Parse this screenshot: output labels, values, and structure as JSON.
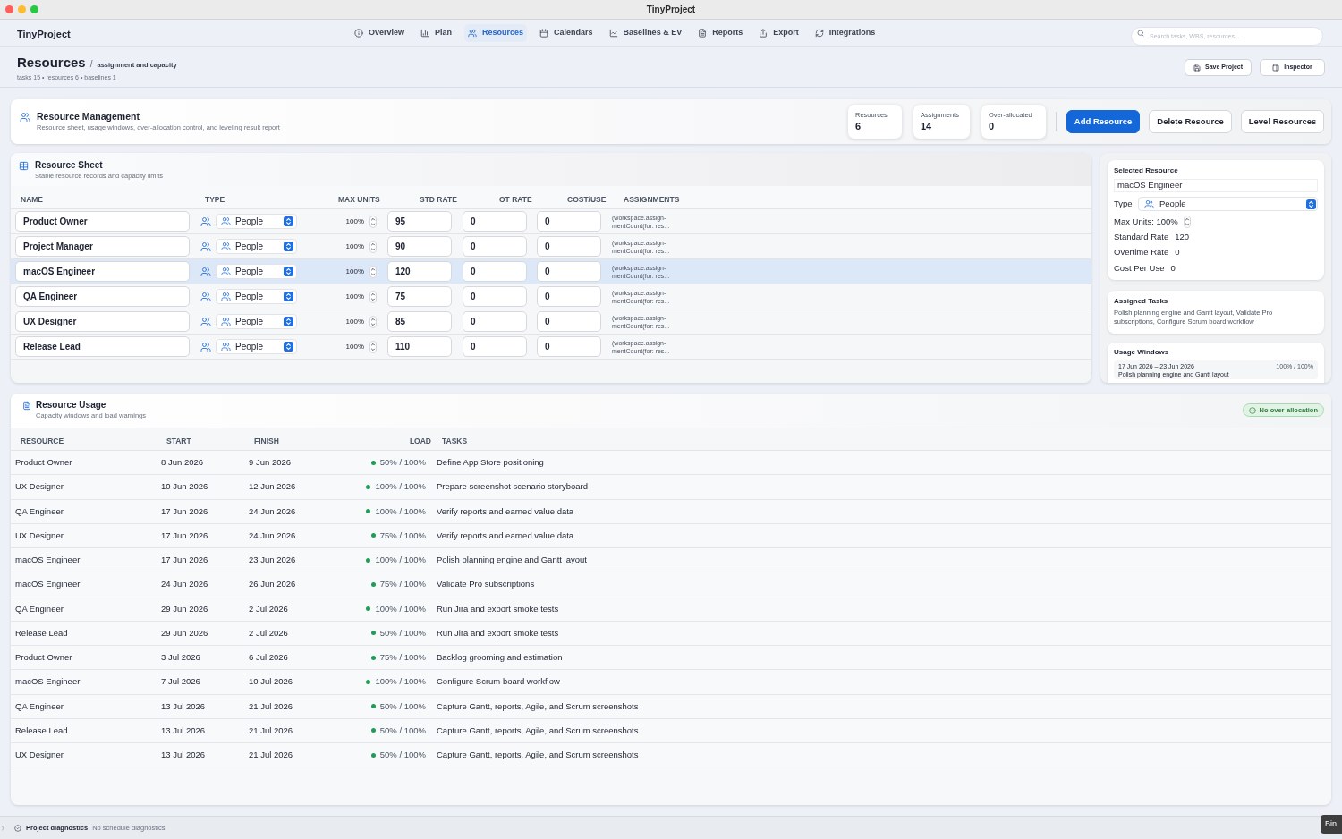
{
  "window": {
    "title": "TinyProject"
  },
  "toolbar": {
    "app_name": "TinyProject",
    "nav": [
      {
        "label": "Overview",
        "selected": false
      },
      {
        "label": "Plan",
        "selected": false
      },
      {
        "label": "Resources",
        "selected": true
      },
      {
        "label": "Calendars",
        "selected": false
      },
      {
        "label": "Baselines & EV",
        "selected": false
      },
      {
        "label": "Reports",
        "selected": false
      },
      {
        "label": "Export",
        "selected": false
      },
      {
        "label": "Integrations",
        "selected": false
      }
    ],
    "search": {
      "placeholder": "Search tasks, WBS, resources..."
    }
  },
  "page_header": {
    "title": "Resources",
    "separator": "/",
    "subtitle": "assignment and capacity",
    "meta": "tasks 15 • resources 6 • baselines 1",
    "actions": [
      "Save Project",
      "Inspector"
    ]
  },
  "resource_management": {
    "title": "Resource Management",
    "subtitle": "Resource sheet, usage windows, over-allocation control, and leveling result report",
    "stats": [
      {
        "label": "Resources",
        "value": "6"
      },
      {
        "label": "Assignments",
        "value": "14"
      },
      {
        "label": "Over-allocated",
        "value": "0"
      }
    ],
    "buttons": [
      {
        "label": "Add Resource",
        "kind": "primary"
      },
      {
        "label": "Delete Resource",
        "kind": "secondary"
      },
      {
        "label": "Level Resources",
        "kind": "secondary"
      }
    ]
  },
  "resource_sheet": {
    "title": "Resource Sheet",
    "subtitle": "Stable resource records and capacity limits",
    "columns": [
      "NAME",
      "TYPE",
      "MAX UNITS",
      "STD RATE",
      "OT RATE",
      "COST/USE",
      "ASSIGNMENTS"
    ],
    "rows": [
      {
        "name": "Product Owner",
        "type": "People",
        "max_units": "100%",
        "std_rate": "95",
        "ot_rate": "0",
        "cost_use": "0",
        "assignments": [
          "(workspace.assign-",
          "mentCount(for: res..."
        ],
        "selected": false
      },
      {
        "name": "Project Manager",
        "type": "People",
        "max_units": "100%",
        "std_rate": "90",
        "ot_rate": "0",
        "cost_use": "0",
        "assignments": [
          "(workspace.assign-",
          "mentCount(for: res..."
        ],
        "selected": false
      },
      {
        "name": "macOS Engineer",
        "type": "People",
        "max_units": "100%",
        "std_rate": "120",
        "ot_rate": "0",
        "cost_use": "0",
        "assignments": [
          "(workspace.assign-",
          "mentCount(for: res..."
        ],
        "selected": true
      },
      {
        "name": "QA Engineer",
        "type": "People",
        "max_units": "100%",
        "std_rate": "75",
        "ot_rate": "0",
        "cost_use": "0",
        "assignments": [
          "(workspace.assign-",
          "mentCount(for: res..."
        ],
        "selected": false
      },
      {
        "name": "UX Designer",
        "type": "People",
        "max_units": "100%",
        "std_rate": "85",
        "ot_rate": "0",
        "cost_use": "0",
        "assignments": [
          "(workspace.assign-",
          "mentCount(for: res..."
        ],
        "selected": false
      },
      {
        "name": "Release Lead",
        "type": "People",
        "max_units": "100%",
        "std_rate": "110",
        "ot_rate": "0",
        "cost_use": "0",
        "assignments": [
          "(workspace.assign-",
          "mentCount(for: res..."
        ],
        "selected": false
      }
    ]
  },
  "inspector": {
    "selected_resource": {
      "title": "Selected Resource",
      "name": "macOS Engineer",
      "type_label": "Type",
      "type": "People",
      "max_units": "Max Units: 100%",
      "fields": [
        {
          "label": "Standard Rate",
          "value": "120"
        },
        {
          "label": "Overtime Rate",
          "value": "0"
        },
        {
          "label": "Cost Per Use",
          "value": "0"
        }
      ]
    },
    "assigned_tasks": {
      "title": "Assigned Tasks",
      "text": "Polish planning engine and Gantt layout, Validate Pro subscriptions, Configure Scrum board workflow"
    },
    "usage_windows": {
      "title": "Usage Windows",
      "items": [
        {
          "range": "17 Jun 2026 – 23 Jun 2026",
          "load": "100% / 100%",
          "task": "Polish planning engine and Gantt layout"
        }
      ]
    }
  },
  "resource_usage": {
    "title": "Resource Usage",
    "subtitle": "Capacity windows and load warnings",
    "badge": "No over-allocation",
    "columns": [
      "RESOURCE",
      "START",
      "FINISH",
      "LOAD",
      "TASKS"
    ],
    "rows": [
      {
        "resource": "Product Owner",
        "start": "8 Jun 2026",
        "finish": "9 Jun 2026",
        "load": "50% / 100%",
        "color": "#1f9d55",
        "tasks": "Define App Store positioning"
      },
      {
        "resource": "UX Designer",
        "start": "10 Jun 2026",
        "finish": "12 Jun 2026",
        "load": "100% / 100%",
        "color": "#1f9d55",
        "tasks": "Prepare screenshot scenario storyboard"
      },
      {
        "resource": "QA Engineer",
        "start": "17 Jun 2026",
        "finish": "24 Jun 2026",
        "load": "100% / 100%",
        "color": "#1f9d55",
        "tasks": "Verify reports and earned value data"
      },
      {
        "resource": "UX Designer",
        "start": "17 Jun 2026",
        "finish": "24 Jun 2026",
        "load": "75% / 100%",
        "color": "#1f9d55",
        "tasks": "Verify reports and earned value data"
      },
      {
        "resource": "macOS Engineer",
        "start": "17 Jun 2026",
        "finish": "23 Jun 2026",
        "load": "100% / 100%",
        "color": "#1f9d55",
        "tasks": "Polish planning engine and Gantt layout"
      },
      {
        "resource": "macOS Engineer",
        "start": "24 Jun 2026",
        "finish": "26 Jun 2026",
        "load": "75% / 100%",
        "color": "#1f9d55",
        "tasks": "Validate Pro subscriptions"
      },
      {
        "resource": "QA Engineer",
        "start": "29 Jun 2026",
        "finish": "2 Jul 2026",
        "load": "100% / 100%",
        "color": "#1f9d55",
        "tasks": "Run Jira and export smoke tests"
      },
      {
        "resource": "Release Lead",
        "start": "29 Jun 2026",
        "finish": "2 Jul 2026",
        "load": "50% / 100%",
        "color": "#1f9d55",
        "tasks": "Run Jira and export smoke tests"
      },
      {
        "resource": "Product Owner",
        "start": "3 Jul 2026",
        "finish": "6 Jul 2026",
        "load": "75% / 100%",
        "color": "#1f9d55",
        "tasks": "Backlog grooming and estimation"
      },
      {
        "resource": "macOS Engineer",
        "start": "7 Jul 2026",
        "finish": "10 Jul 2026",
        "load": "100% / 100%",
        "color": "#1f9d55",
        "tasks": "Configure Scrum board workflow"
      },
      {
        "resource": "QA Engineer",
        "start": "13 Jul 2026",
        "finish": "21 Jul 2026",
        "load": "50% / 100%",
        "color": "#1f9d55",
        "tasks": "Capture Gantt, reports, Agile, and Scrum screenshots"
      },
      {
        "resource": "Release Lead",
        "start": "13 Jul 2026",
        "finish": "21 Jul 2026",
        "load": "50% / 100%",
        "color": "#1f9d55",
        "tasks": "Capture Gantt, reports, Agile, and Scrum screenshots"
      },
      {
        "resource": "UX Designer",
        "start": "13 Jul 2026",
        "finish": "21 Jul 2026",
        "load": "50% / 100%",
        "color": "#1f9d55",
        "tasks": "Capture Gantt, reports, Agile, and Scrum screenshots"
      }
    ]
  },
  "status_bar": {
    "title": "Project diagnostics",
    "text": "No schedule diagnostics"
  },
  "tooltip": {
    "text": "Bin"
  }
}
